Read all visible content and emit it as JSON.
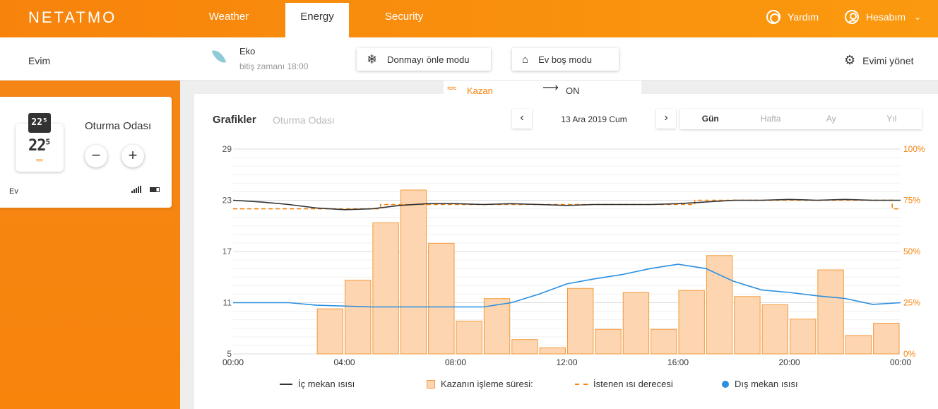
{
  "nav": {
    "logo": "NETATMO",
    "tabs": [
      "Weather",
      "Energy",
      "Security"
    ],
    "active_tab": "Energy",
    "help_label": "Yardım",
    "account_label": "Hesabım"
  },
  "home": {
    "name": "Evim",
    "mode_title": "Eko",
    "mode_sub": "bitiş zamanı 18:00",
    "frost_button": "Donmayı önle modu",
    "away_button": "Ev boş modu",
    "manage_label": "Evimi yönet"
  },
  "boiler": {
    "label": "Kazan",
    "state": "ON"
  },
  "room": {
    "badge": "22⁵",
    "temp_main": "22",
    "temp_dec": "5",
    "title": "Oturma Odası",
    "minus": "−",
    "plus": "+",
    "home_label": "Ev"
  },
  "graph": {
    "title": "Grafikler",
    "room": "Oturma Odası",
    "date": "13 Ara 2019 Cum",
    "prev": "‹",
    "next": "›",
    "periods": [
      "Gün",
      "Hafta",
      "Ay",
      "Yıl"
    ],
    "selected_period": "Gün"
  },
  "legend": {
    "indoor": "İç mekan ısısı",
    "boiler": "Kazanın işleme süresi:",
    "setpoint": "İstenen ısı derecesi",
    "outdoor": "Dış mekan ısısı"
  },
  "colors": {
    "accent": "#f7830c",
    "indoor": "#333333",
    "outdoor": "#2a8fe0",
    "bar_fill": "#fdd5b0",
    "bar_stroke": "#f39a3c"
  },
  "chart_data": {
    "type": "bar",
    "x_ticks": [
      "00:00",
      "04:00",
      "08:00",
      "12:00",
      "16:00",
      "20:00",
      "00:00"
    ],
    "y_left_ticks": [
      "29",
      "23",
      "17",
      "11",
      "5"
    ],
    "y_right_ticks": [
      "100%",
      "75%",
      "50%",
      "25%",
      "0%"
    ],
    "ylim_left": [
      5,
      29
    ],
    "ylim_right": [
      0,
      100
    ],
    "grid": true,
    "legend_position": "bottom",
    "boiler_runtime_percent": [
      {
        "hour": 3,
        "value": 22
      },
      {
        "hour": 4,
        "value": 36
      },
      {
        "hour": 5,
        "value": 64
      },
      {
        "hour": 6,
        "value": 80
      },
      {
        "hour": 7,
        "value": 54
      },
      {
        "hour": 8,
        "value": 16
      },
      {
        "hour": 9,
        "value": 27
      },
      {
        "hour": 10,
        "value": 7
      },
      {
        "hour": 11,
        "value": 3
      },
      {
        "hour": 12,
        "value": 32
      },
      {
        "hour": 13,
        "value": 12
      },
      {
        "hour": 14,
        "value": 30
      },
      {
        "hour": 15,
        "value": 12
      },
      {
        "hour": 16,
        "value": 31
      },
      {
        "hour": 17,
        "value": 48
      },
      {
        "hour": 18,
        "value": 28
      },
      {
        "hour": 19,
        "value": 24
      },
      {
        "hour": 20,
        "value": 17
      },
      {
        "hour": 21,
        "value": 41
      },
      {
        "hour": 22,
        "value": 9
      },
      {
        "hour": 23,
        "value": 15
      }
    ],
    "indoor_temperature": [
      [
        0,
        23.0
      ],
      [
        1,
        22.8
      ],
      [
        2,
        22.5
      ],
      [
        3,
        22.1
      ],
      [
        4,
        21.9
      ],
      [
        5,
        22.0
      ],
      [
        6,
        22.4
      ],
      [
        7,
        22.6
      ],
      [
        8,
        22.6
      ],
      [
        9,
        22.5
      ],
      [
        10,
        22.6
      ],
      [
        11,
        22.5
      ],
      [
        12,
        22.4
      ],
      [
        13,
        22.5
      ],
      [
        14,
        22.5
      ],
      [
        15,
        22.5
      ],
      [
        16,
        22.6
      ],
      [
        17,
        22.8
      ],
      [
        18,
        23.0
      ],
      [
        19,
        23.0
      ],
      [
        20,
        23.1
      ],
      [
        21,
        23.0
      ],
      [
        22,
        23.1
      ],
      [
        23,
        23.0
      ],
      [
        24,
        23.0
      ]
    ],
    "setpoint_temperature": [
      [
        0,
        22.0
      ],
      [
        3.5,
        22.0
      ],
      [
        5.3,
        22.0
      ],
      [
        5.3,
        22.5
      ],
      [
        16.6,
        22.5
      ],
      [
        16.6,
        23.0
      ],
      [
        23.7,
        23.0
      ],
      [
        23.7,
        22.0
      ],
      [
        24,
        22.0
      ]
    ],
    "outdoor_temperature": [
      [
        0,
        11.0
      ],
      [
        2,
        11.0
      ],
      [
        3,
        10.7
      ],
      [
        5,
        10.5
      ],
      [
        7,
        10.5
      ],
      [
        9,
        10.5
      ],
      [
        10,
        11.0
      ],
      [
        11,
        12.0
      ],
      [
        12,
        13.2
      ],
      [
        13,
        13.8
      ],
      [
        14,
        14.3
      ],
      [
        15,
        15.0
      ],
      [
        16,
        15.5
      ],
      [
        17,
        15.0
      ],
      [
        18,
        13.5
      ],
      [
        19,
        12.5
      ],
      [
        20,
        12.2
      ],
      [
        21,
        11.8
      ],
      [
        22,
        11.5
      ],
      [
        23,
        10.8
      ],
      [
        24,
        11.0
      ]
    ]
  }
}
